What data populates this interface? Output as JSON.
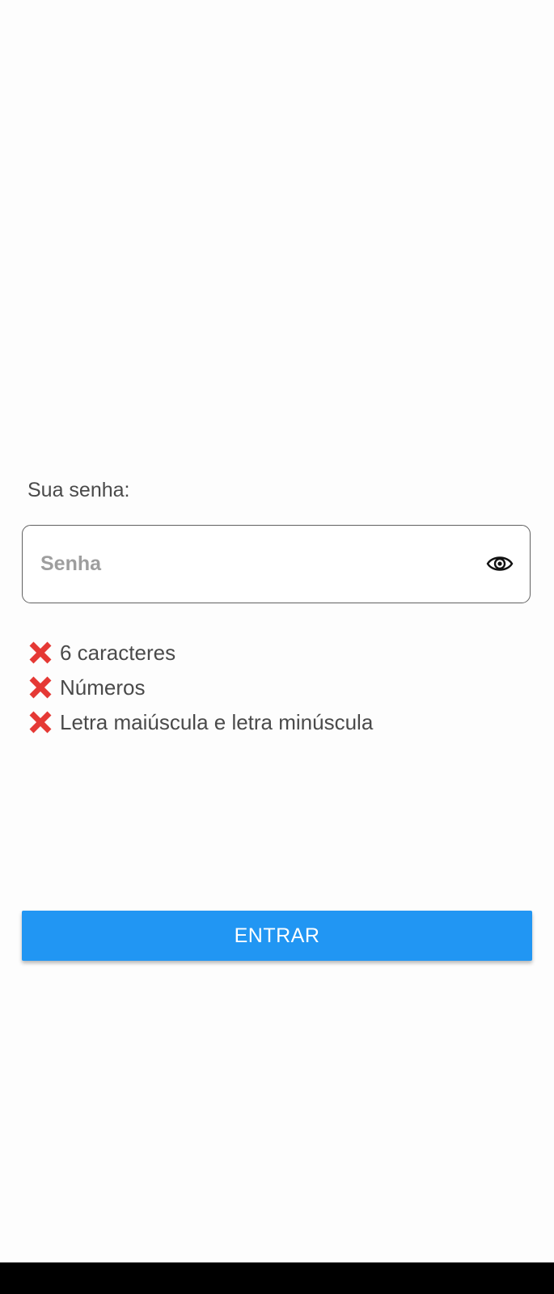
{
  "password": {
    "label": "Sua senha:",
    "value": "",
    "placeholder": "Senha",
    "toggle_icon": "eye-icon"
  },
  "rules": [
    {
      "text": "6 caracteres",
      "status": "unmet",
      "icon": "cross-mark-icon"
    },
    {
      "text": "Números",
      "status": "unmet",
      "icon": "cross-mark-icon"
    },
    {
      "text": "Letra maiúscula e letra minúscula",
      "status": "unmet",
      "icon": "cross-mark-icon"
    }
  ],
  "submit": {
    "label": "ENTRAR"
  },
  "colors": {
    "accent": "#2196f3",
    "error": "#e53935",
    "background": "#fdfdfd",
    "nav_bar": "#000000"
  }
}
